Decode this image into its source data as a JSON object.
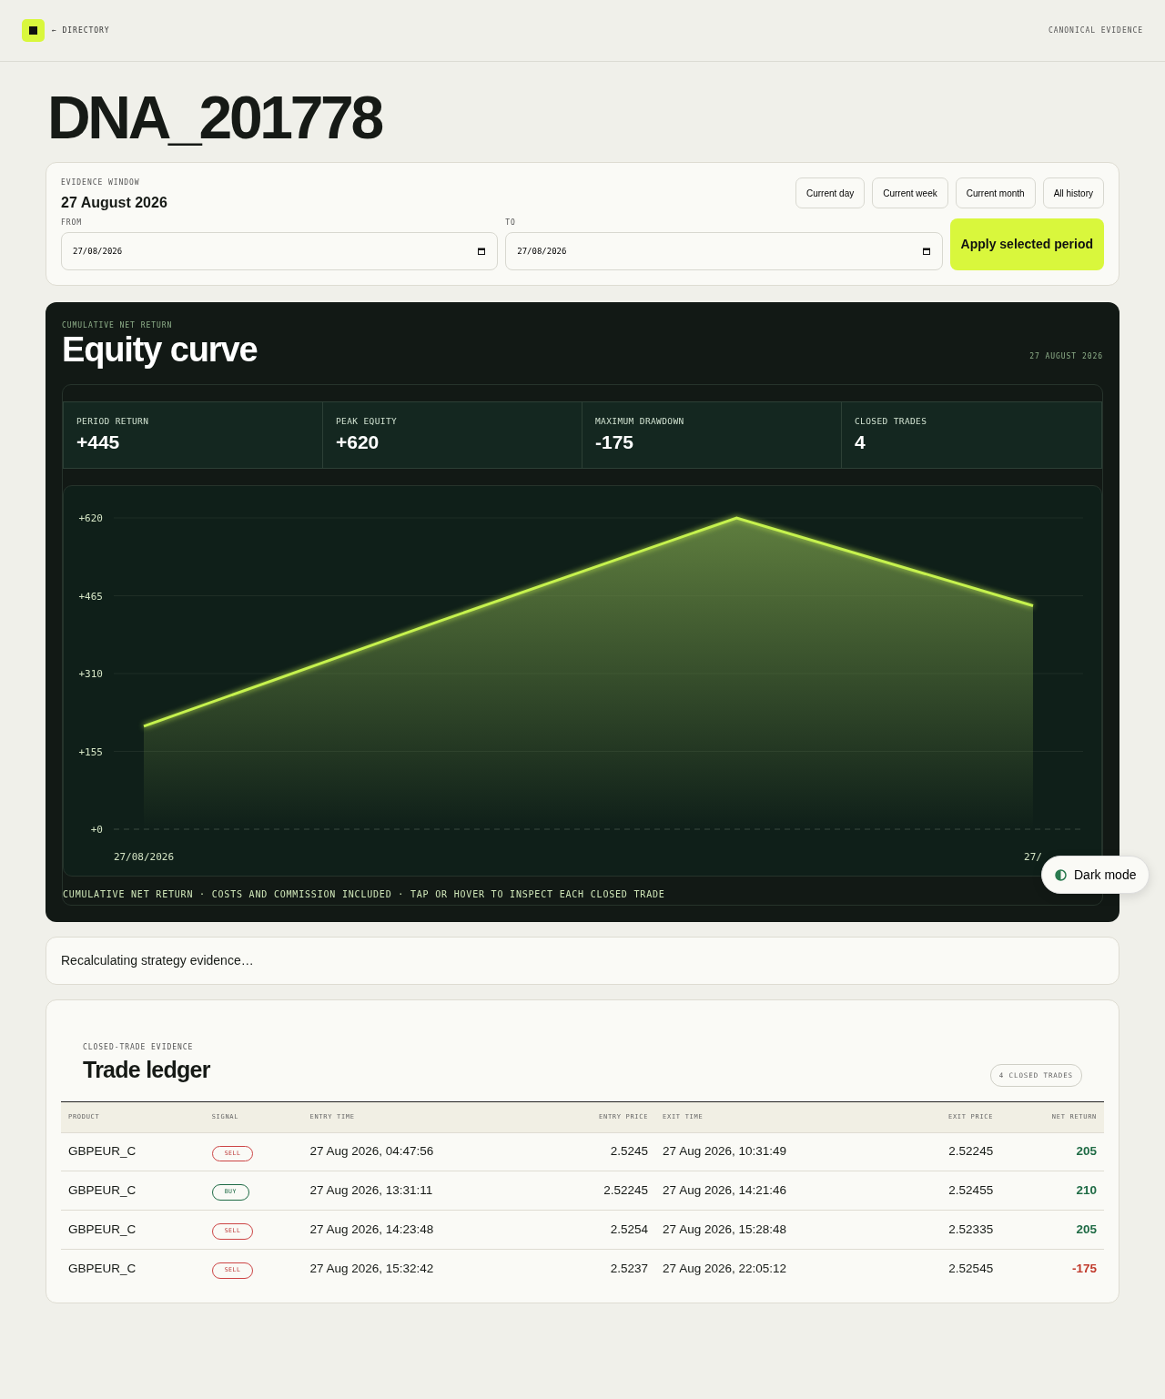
{
  "header": {
    "back_link": "← DIRECTORY",
    "right_label": "CANONICAL EVIDENCE"
  },
  "title": "DNA_201778",
  "evidence_window": {
    "eyebrow": "EVIDENCE WINDOW",
    "date": "27 August 2026",
    "presets": [
      "Current day",
      "Current week",
      "Current month",
      "All history"
    ],
    "from": {
      "label": "FROM",
      "value": "27/08/2026"
    },
    "to": {
      "label": "TO",
      "value": "27/08/2026"
    },
    "apply_button": "Apply selected period"
  },
  "equity": {
    "eyebrow": "CUMULATIVE NET RETURN",
    "title": "Equity curve",
    "date": "27 AUGUST 2026",
    "stats": [
      {
        "label": "PERIOD RETURN",
        "value": "+445"
      },
      {
        "label": "PEAK EQUITY",
        "value": "+620"
      },
      {
        "label": "MAXIMUM DRAWDOWN",
        "value": "-175"
      },
      {
        "label": "CLOSED TRADES",
        "value": "4"
      }
    ],
    "chart_data": {
      "type": "area",
      "categories": [
        "27/08/2026",
        null,
        null,
        "27/"
      ],
      "series": [
        {
          "color": "#c6f24e",
          "values": [
            205,
            415,
            620,
            445
          ]
        }
      ],
      "ylim": [
        0,
        620
      ],
      "yticks": [
        {
          "value": 0,
          "label": "+0"
        },
        {
          "value": 155,
          "label": "+155"
        },
        {
          "value": 310,
          "label": "+310"
        },
        {
          "value": 465,
          "label": "+465"
        },
        {
          "value": 620,
          "label": "+620"
        }
      ],
      "grid": true
    },
    "footnote": "CUMULATIVE NET RETURN · COSTS AND COMMISSION INCLUDED · TAP OR HOVER TO INSPECT EACH CLOSED TRADE"
  },
  "dark_mode_button": "Dark mode",
  "status_message": "Recalculating strategy evidence…",
  "ledger": {
    "eyebrow": "CLOSED-TRADE EVIDENCE",
    "title": "Trade ledger",
    "count_badge": "4 CLOSED TRADES",
    "columns": [
      "PRODUCT",
      "SIGNAL",
      "ENTRY TIME",
      "ENTRY PRICE",
      "EXIT TIME",
      "EXIT PRICE",
      "NET RETURN"
    ],
    "rows": [
      {
        "product": "GBPEUR_C",
        "signal": "SELL",
        "kind": "sell",
        "entry_time": "27 Aug 2026, 04:47:56",
        "entry_price": "2.5245",
        "exit_time": "27 Aug 2026, 10:31:49",
        "exit_price": "2.52245",
        "net_return": "205",
        "color": "#1f6b45"
      },
      {
        "product": "GBPEUR_C",
        "signal": "BUY",
        "kind": "buy",
        "entry_time": "27 Aug 2026, 13:31:11",
        "entry_price": "2.52245",
        "exit_time": "27 Aug 2026, 14:21:46",
        "exit_price": "2.52455",
        "net_return": "210",
        "color": "#1f6b45"
      },
      {
        "product": "GBPEUR_C",
        "signal": "SELL",
        "kind": "sell",
        "entry_time": "27 Aug 2026, 14:23:48",
        "entry_price": "2.5254",
        "exit_time": "27 Aug 2026, 15:28:48",
        "exit_price": "2.52335",
        "net_return": "205",
        "color": "#1f6b45"
      },
      {
        "product": "GBPEUR_C",
        "signal": "SELL",
        "kind": "sell",
        "entry_time": "27 Aug 2026, 15:32:42",
        "entry_price": "2.5237",
        "exit_time": "27 Aug 2026, 22:05:12",
        "exit_price": "2.52545",
        "net_return": "-175",
        "color": "#c0392b"
      }
    ]
  }
}
